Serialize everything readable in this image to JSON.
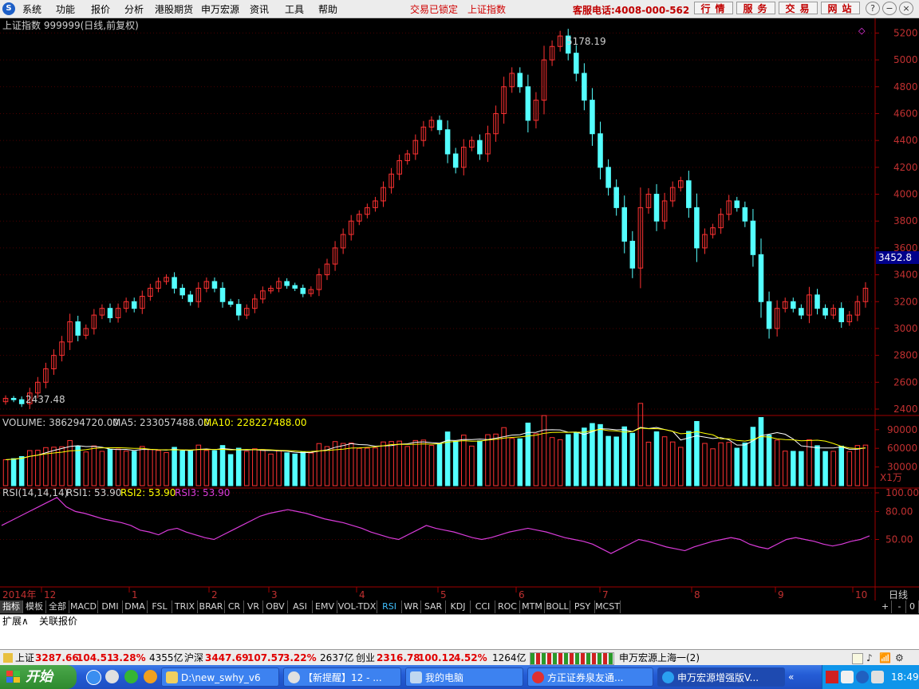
{
  "menubar": {
    "items": [
      "系统",
      "功能",
      "报价",
      "分析",
      "港股期货",
      "申万宏源",
      "资讯",
      "工具",
      "帮助"
    ],
    "trade_locked": "交易已锁定",
    "index_name": "上证指数",
    "hotline": "客服电话:4008-000-562",
    "nav_buttons": [
      "行情",
      "服务",
      "交易",
      "网站"
    ]
  },
  "chart": {
    "title": "上证指数 999999(日线,前复权)",
    "price_ticks": [
      "5200",
      "5000",
      "4800",
      "4600",
      "4400",
      "4200",
      "4000",
      "3800",
      "3600",
      "3400",
      "3200",
      "3000",
      "2800",
      "2600",
      "2400"
    ],
    "current_price": "3452.8",
    "high_label": "5178.19",
    "low_label": "2437.48",
    "volume_header": {
      "vol": "VOLUME: 386294720.00",
      "ma5": "MA5: 233057488.00",
      "ma10": "MA10: 228227488.00"
    },
    "volume_ticks": [
      "90000",
      "60000",
      "30000"
    ],
    "volume_unit": "X1万",
    "rsi_header": {
      "name": "RSI(14,14,14)",
      "rsi1": "RSI1: 53.90",
      "rsi2": "RSI2: 53.90",
      "rsi3": "RSI3: 53.90"
    },
    "rsi_ticks": [
      "100.00",
      "80.00",
      "50.00"
    ],
    "x_labels": [
      "2014年",
      "12",
      "1",
      "2",
      "3",
      "4",
      "5",
      "6",
      "7",
      "8",
      "9",
      "10"
    ],
    "period": "日线",
    "colors": {
      "up": "#ff3232",
      "down": "#54ffff",
      "rsi": "#d93bd9",
      "ma5": "#ffffff",
      "ma10": "#ffff00"
    }
  },
  "chart_data": {
    "type": "candlestick",
    "title": "上证指数 999999(日线,前复权)",
    "ylim": [
      2400,
      5250
    ],
    "close": [
      2480,
      2470,
      2440,
      2520,
      2600,
      2700,
      2800,
      2900,
      3050,
      2950,
      3000,
      3100,
      3150,
      3080,
      3150,
      3200,
      3150,
      3240,
      3300,
      3350,
      3380,
      3300,
      3250,
      3200,
      3300,
      3350,
      3300,
      3200,
      3180,
      3100,
      3150,
      3220,
      3280,
      3300,
      3350,
      3320,
      3300,
      3260,
      3290,
      3400,
      3480,
      3600,
      3700,
      3800,
      3850,
      3900,
      3950,
      4050,
      4150,
      4250,
      4300,
      4400,
      4500,
      4550,
      4480,
      4300,
      4200,
      4350,
      4400,
      4300,
      4450,
      4600,
      4800,
      4900,
      4800,
      4550,
      4700,
      5000,
      5100,
      5178,
      5050,
      4900,
      4700,
      4450,
      4200,
      4050,
      3900,
      3650,
      3450,
      3900,
      4000,
      3800,
      3950,
      4050,
      4100,
      3900,
      3600,
      3700,
      3750,
      3850,
      3950,
      3900,
      3800,
      3550,
      3200,
      3000,
      3150,
      3200,
      3150,
      3100,
      3250,
      3150,
      3100,
      3150,
      3050,
      3100,
      3200,
      3300
    ],
    "volume_ticks": [
      90000,
      60000,
      30000
    ],
    "rsi": [
      65,
      70,
      75,
      80,
      85,
      90,
      95,
      85,
      80,
      78,
      75,
      72,
      70,
      68,
      65,
      60,
      58,
      55,
      60,
      62,
      58,
      55,
      52,
      50,
      55,
      60,
      65,
      70,
      75,
      78,
      80,
      82,
      80,
      78,
      75,
      72,
      70,
      68,
      65,
      62,
      58,
      55,
      52,
      50,
      55,
      60,
      65,
      62,
      60,
      58,
      55,
      52,
      50,
      52,
      55,
      58,
      60,
      62,
      60,
      58,
      55,
      52,
      50,
      48,
      45,
      40,
      35,
      40,
      45,
      50,
      48,
      45,
      42,
      40,
      38,
      42,
      45,
      48,
      50,
      52,
      50,
      45,
      42,
      40,
      45,
      50,
      52,
      50,
      48,
      45,
      43,
      45,
      48,
      50,
      53.9
    ],
    "rsi_ylim": [
      0,
      100
    ]
  },
  "tabs": [
    "指标",
    "模板",
    "全部",
    "MACD",
    "DMI",
    "DMA",
    "FSL",
    "TRIX",
    "BRAR",
    "CR",
    "VR",
    "OBV",
    "ASI",
    "EMV",
    "VOL-TDX",
    "RSI",
    "WR",
    "SAR",
    "KDJ",
    "CCI",
    "ROC",
    "MTM",
    "BOLL",
    "PSY",
    "MCST"
  ],
  "active_tab": "RSI",
  "tab_right": [
    "+",
    "-",
    "0"
  ],
  "extbar": {
    "expand": "扩展∧",
    "linked": "关联报价"
  },
  "status": {
    "sh_label": "上证",
    "sh_price": "3287.66",
    "sh_chg": "104.51",
    "sh_pct": "3.28%",
    "sh_amt": "4355亿",
    "hs_label": "沪深",
    "hs_price": "3447.69",
    "hs_chg": "107.57",
    "hs_pct": "3.22%",
    "hs_amt": "2637亿",
    "cy_label": "创业",
    "cy_price": "2316.78",
    "cy_chg": "100.12",
    "cy_pct": "4.52%",
    "cy_amt": "1264亿",
    "server": "申万宏源上海一(2)"
  },
  "taskbar": {
    "start": "开始",
    "buttons": [
      "D:\\new_swhy_v6",
      "【新提醒】12 - ...",
      "我的电脑",
      "方正证券泉友通...",
      "申万宏源增强版V..."
    ],
    "clock": "18:49"
  }
}
